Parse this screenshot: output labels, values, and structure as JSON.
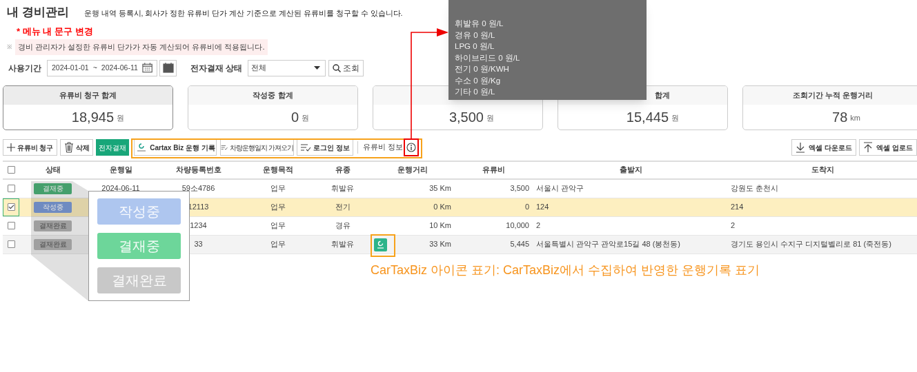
{
  "page": {
    "title": "내 경비관리",
    "description": "운행 내역 등록시, 회사가 정한 유류비 단가 계산 기준으로 계산된 유류비를 청구할 수 있습니다."
  },
  "annotation_note": "* 메뉴 내 문구 변경",
  "notice": {
    "mark": "※",
    "text": "경비 관리자가 설정한 유류비 단가가 자동 계산되어 유류비에 적용됩니다."
  },
  "filters": {
    "period_label": "사용기간",
    "start": "2024-01-01",
    "separator": "~",
    "end": "2024-06-11",
    "status_label": "전자결재 상태",
    "status_value": "전체",
    "search_button": "조회"
  },
  "summary_cards": [
    {
      "title": "유류비 청구 합계",
      "value": "18,945",
      "unit": "원",
      "selected": true
    },
    {
      "title": "작성중 합계",
      "value": "0",
      "unit": "원",
      "selected": false
    },
    {
      "value": "3,500",
      "unit": "원",
      "selected": false
    },
    {
      "title": "합계",
      "value": "15,445",
      "unit": "원",
      "selected": false
    },
    {
      "title": "조회기간 누적 운행거리",
      "value": "78",
      "unit": "km",
      "selected": false
    }
  ],
  "toolbar": {
    "buttons": [
      {
        "kind": "add",
        "label": "유류비 청구"
      },
      {
        "kind": "delete",
        "label": "삭제"
      },
      {
        "kind": "approve",
        "label": "전자결재"
      },
      {
        "kind": "cartax",
        "label": "Cartax Biz 운행 기록"
      },
      {
        "kind": "import",
        "label": "차량운행일지 가져오기"
      },
      {
        "kind": "login",
        "label": "로그인 정보"
      }
    ],
    "fuel_info_label": "유류비 정보",
    "right_buttons": [
      {
        "kind": "download",
        "label": "엑셀 다운로드"
      },
      {
        "kind": "upload",
        "label": "엑셀 업로드"
      }
    ]
  },
  "table": {
    "all_checked": false,
    "columns": [
      "상태",
      "운행일",
      "차량등록번호",
      "운행목적",
      "유종",
      "운행거리",
      "유류비",
      "출발지",
      "도착지"
    ],
    "rows": [
      {
        "checked": false,
        "selected": false,
        "hovered": false,
        "cartax": false,
        "status": {
          "label": "결재중",
          "kind": "approving"
        },
        "date": "2024-06-11",
        "vehicle": "59소4786",
        "purpose": "업무",
        "fuel": "휘발유",
        "distance": "35 Km",
        "cost": "3,500",
        "from": "서울시 관악구",
        "to": "강원도 춘천시"
      },
      {
        "checked": true,
        "selected": true,
        "hovered": false,
        "cartax": false,
        "status": {
          "label": "작성중",
          "kind": "draft"
        },
        "vehicle": "12113",
        "purpose": "업무",
        "fuel": "전기",
        "distance": "0 Km",
        "cost": "0",
        "from": "124",
        "to": "214"
      },
      {
        "checked": false,
        "selected": false,
        "hovered": false,
        "cartax": false,
        "status": {
          "label": "결재완료",
          "kind": "done"
        },
        "vehicle": "1234",
        "purpose": "업무",
        "fuel": "경유",
        "distance": "10 Km",
        "cost": "10,000",
        "from": "2",
        "to": "2"
      },
      {
        "checked": false,
        "selected": false,
        "hovered": true,
        "cartax": true,
        "status": {
          "label": "결재완료",
          "kind": "done"
        },
        "vehicle": "33",
        "purpose": "업무",
        "fuel": "휘발유",
        "distance": "33 Km",
        "cost": "5,445",
        "from": "서울특별시 관악구 관악로15길 48 (봉천동)",
        "to": "경기도 용인시 수지구 디지털벨리로 81 (죽전동)"
      }
    ]
  },
  "status_callout": [
    {
      "label": "작성중",
      "kind": "draft"
    },
    {
      "label": "결재중",
      "kind": "approving"
    },
    {
      "label": "결재완료",
      "kind": "done"
    }
  ],
  "tooltip": {
    "lines": [
      "휘발유 0 원/L",
      "경유 0 원/L",
      "LPG 0 원/L",
      "하이브리드 0 원/L",
      "전기 0 원/KWH",
      "수소 0 원/Kg",
      "기타 0 원/L"
    ]
  },
  "cartax_annotation": "CarTaxBiz 아이콘 표기: CarTaxBiz에서 수집하여 반영한 운행기록 표기"
}
